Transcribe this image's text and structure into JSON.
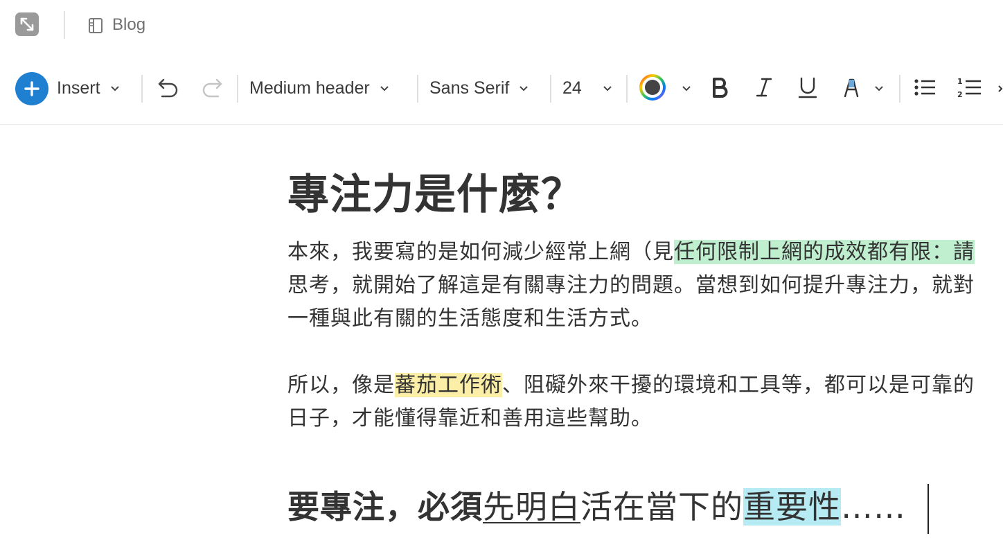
{
  "topbar": {
    "title": "Blog",
    "expand_icon": "expand-arrows-icon",
    "doc_icon": "document-icon"
  },
  "toolbar": {
    "insert_label": "Insert",
    "block_style": "Medium header",
    "font_family": "Sans Serif",
    "font_size": "24",
    "colors": {
      "accent": "#1f7fd1",
      "text_color": "#3a3a3a"
    },
    "icons": [
      "plus-icon",
      "undo-icon",
      "redo-icon",
      "color-wheel-icon",
      "bold-icon",
      "italic-icon",
      "underline-icon",
      "highlighter-icon",
      "bullet-list-icon",
      "numbered-list-icon"
    ]
  },
  "document": {
    "heading1": "專注力是什麼？",
    "para1": {
      "line1_plain": "本來，我要寫的是如何減少經常上網（見",
      "line1_highlight": "任何限制上網的成效都有限：請",
      "line2": "思考，就開始了解這是有關專注力的問題。當想到如何提升專注力，就對",
      "line3": "一種與此有關的生活態度和生活方式。"
    },
    "para2": {
      "line1_pre": "所以，像是",
      "line1_highlight": "蕃茄工作術",
      "line1_post": "、阻礙外來干擾的環境和工具等，都可以是可靠的",
      "line2": "日子，才能懂得靠近和善用這些幫助。"
    },
    "heading2": {
      "part1": "要專注，必須",
      "part2_underlined": "先明白",
      "part3": "活在當下的",
      "part4_highlight": "重要性",
      "part5": "……"
    },
    "highlight_colors": {
      "green": "#bfefcf",
      "yellow": "#fbeea6",
      "cyan": "#b7ebf3"
    }
  }
}
